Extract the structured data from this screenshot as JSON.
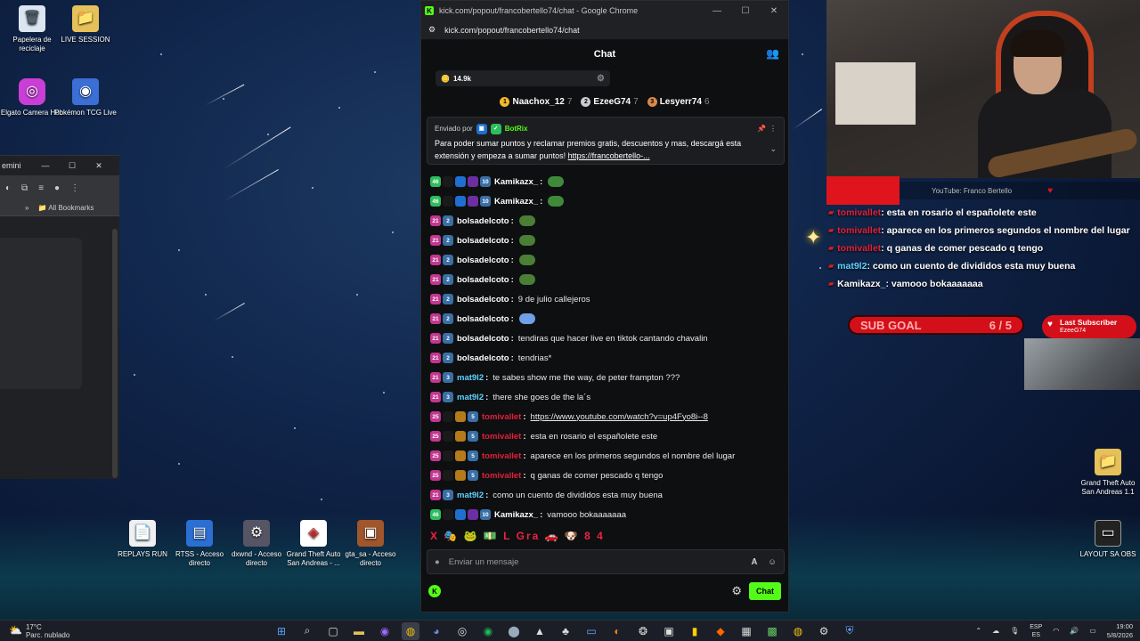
{
  "desktop": {
    "icons": [
      {
        "label": "Papelera de reciclaje",
        "glyph": "🗑"
      },
      {
        "label": "LIVE SESSION",
        "glyph": "📁"
      },
      {
        "label": "Elgato Camera Hub",
        "glyph": "◎"
      },
      {
        "label": "Pokémon TCG Live",
        "glyph": "◉"
      },
      {
        "label": "REPLAYS RUN",
        "glyph": "📄"
      },
      {
        "label": "RTSS - Acceso directo",
        "glyph": "▤"
      },
      {
        "label": "dxwnd - Acceso directo",
        "glyph": "⚙"
      },
      {
        "label": "Grand Theft Auto San Andreas - ...",
        "glyph": "◈"
      },
      {
        "label": "gta_sa - Acceso directo",
        "glyph": "▣"
      },
      {
        "label": "Grand Theft Auto San Andreas 1.1",
        "glyph": "📁"
      },
      {
        "label": "LAYOUT SA OBS",
        "glyph": "▭"
      }
    ]
  },
  "bg_window": {
    "title": "emini",
    "bookmarks": "All Bookmarks",
    "bookmarks_chevron": "»"
  },
  "chat_window": {
    "title": "kick.com/popout/francobertello74/chat - Google Chrome",
    "url": "kick.com/popout/francobertello74/chat",
    "header": "Chat",
    "points": "14.9k",
    "leaderboard": [
      {
        "rank": "1",
        "name": "Naachox_12",
        "count": "7",
        "color": "#f5b829"
      },
      {
        "rank": "2",
        "name": "EzeeG74",
        "count": "7",
        "color": "#c9ccd1"
      },
      {
        "rank": "3",
        "name": "Lesyerr74",
        "count": "6",
        "color": "#d88a4a"
      }
    ],
    "pinned": {
      "sent_by": "Enviado por",
      "bot": "BotRix",
      "text": "Para poder sumar puntos y reclamar premios gratis, descuentos y mas, descargá esta extensión y empeza a sumar puntos!",
      "link": "https://francobertello-..."
    },
    "messages": [
      {
        "user": "Kamikazx_",
        "sep": ":",
        "text": "",
        "color": "#ffffff",
        "badges": [
          "#2dbd5e",
          "#1a1a1a",
          "#1f6fd1",
          "#6b2ea3",
          "#3a6fa5"
        ],
        "badge_text": [
          "46",
          "",
          "",
          "",
          "10"
        ],
        "emote": "#3e8a3a"
      },
      {
        "user": "Kamikazx_",
        "sep": ":",
        "text": "",
        "color": "#ffffff",
        "badges": [
          "#2dbd5e",
          "#1a1a1a",
          "#1f6fd1",
          "#6b2ea3",
          "#3a6fa5"
        ],
        "badge_text": [
          "46",
          "",
          "",
          "",
          "10"
        ],
        "emote": "#3e8a3a"
      },
      {
        "user": "bolsadelcoto",
        "sep": ":",
        "text": "",
        "color": "#ffffff",
        "badges": [
          "#c2378f",
          "#3a6fa5"
        ],
        "badge_text": [
          "21",
          "2"
        ],
        "emote": "#4a7f35"
      },
      {
        "user": "bolsadelcoto",
        "sep": ":",
        "text": "",
        "color": "#ffffff",
        "badges": [
          "#c2378f",
          "#3a6fa5"
        ],
        "badge_text": [
          "21",
          "2"
        ],
        "emote": "#4a7f35"
      },
      {
        "user": "bolsadelcoto",
        "sep": ":",
        "text": "",
        "color": "#ffffff",
        "badges": [
          "#c2378f",
          "#3a6fa5"
        ],
        "badge_text": [
          "21",
          "2"
        ],
        "emote": "#4a7f35"
      },
      {
        "user": "bolsadelcoto",
        "sep": ":",
        "text": "",
        "color": "#ffffff",
        "badges": [
          "#c2378f",
          "#3a6fa5"
        ],
        "badge_text": [
          "21",
          "2"
        ],
        "emote": "#4a7f35"
      },
      {
        "user": "bolsadelcoto",
        "sep": ":",
        "text": "9 de julio callejeros",
        "color": "#ffffff",
        "badges": [
          "#c2378f",
          "#3a6fa5"
        ],
        "badge_text": [
          "21",
          "2"
        ]
      },
      {
        "user": "bolsadelcoto",
        "sep": ":",
        "text": "",
        "color": "#ffffff",
        "badges": [
          "#c2378f",
          "#3a6fa5"
        ],
        "badge_text": [
          "21",
          "2"
        ],
        "emote": "#6fa0e8"
      },
      {
        "user": "bolsadelcoto",
        "sep": ":",
        "text": "tendiras que hacer live en tiktok cantando chavalin",
        "color": "#ffffff",
        "badges": [
          "#c2378f",
          "#3a6fa5"
        ],
        "badge_text": [
          "21",
          "2"
        ]
      },
      {
        "user": "bolsadelcoto",
        "sep": ":",
        "text": "tendrias*",
        "color": "#ffffff",
        "badges": [
          "#c2378f",
          "#3a6fa5"
        ],
        "badge_text": [
          "21",
          "2"
        ]
      },
      {
        "user": "mat9l2",
        "sep": ":",
        "text": "te sabes show me the way, de peter frampton ???",
        "color": "#5ed3ff",
        "badges": [
          "#c2378f",
          "#3a6fa5"
        ],
        "badge_text": [
          "21",
          "3"
        ]
      },
      {
        "user": "mat9l2",
        "sep": ":",
        "text": "there she goes de the la´s",
        "color": "#5ed3ff",
        "badges": [
          "#c2378f",
          "#3a6fa5"
        ],
        "badge_text": [
          "21",
          "3"
        ]
      },
      {
        "user": "tomivallet",
        "sep": ":",
        "text": "https://www.youtube.com/watch?v=up4Fyo8i--8",
        "link": true,
        "color": "#e0213a",
        "badges": [
          "#c2378f",
          "#1a1a1a",
          "#b57a1a",
          "#3a6fa5"
        ],
        "badge_text": [
          "25",
          "",
          "",
          "5"
        ]
      },
      {
        "user": "tomivallet",
        "sep": ":",
        "text": "esta en rosario el españolete este",
        "color": "#e0213a",
        "badges": [
          "#c2378f",
          "#1a1a1a",
          "#b57a1a",
          "#3a6fa5"
        ],
        "badge_text": [
          "25",
          "",
          "",
          "5"
        ]
      },
      {
        "user": "tomivallet",
        "sep": ":",
        "text": "aparece en los primeros segundos el nombre del lugar",
        "color": "#e0213a",
        "badges": [
          "#c2378f",
          "#1a1a1a",
          "#b57a1a",
          "#3a6fa5"
        ],
        "badge_text": [
          "25",
          "",
          "",
          "5"
        ]
      },
      {
        "user": "tomivallet",
        "sep": ":",
        "text": "q ganas de comer pescado q tengo",
        "color": "#e0213a",
        "badges": [
          "#c2378f",
          "#1a1a1a",
          "#b57a1a",
          "#3a6fa5"
        ],
        "badge_text": [
          "25",
          "",
          "",
          "5"
        ]
      },
      {
        "user": "mat9l2",
        "sep": ":",
        "text": "como un cuento de divididos esta muy buena",
        "color": "#5ed3ff",
        "badges": [
          "#c2378f",
          "#3a6fa5"
        ],
        "badge_text": [
          "21",
          "3"
        ]
      },
      {
        "user": "Kamikazx_",
        "sep": ":",
        "text": "vamooo bokaaaaaaa",
        "color": "#ffffff",
        "badges": [
          "#2dbd5e",
          "#1a1a1a",
          "#1f6fd1",
          "#6b2ea3",
          "#3a6fa5"
        ],
        "badge_text": [
          "46",
          "",
          "",
          "",
          "10"
        ]
      }
    ],
    "emote_row": "X 🎭 🐸 💵 L Gra 🚗 🐶 8 4",
    "input_placeholder": "Enviar un mensaje",
    "send_label": "Chat"
  },
  "overlay": {
    "yt_label": "YouTube: Franco Bertello",
    "chat": [
      {
        "user": "tomivallet",
        "text": ": esta en rosario el españolete este",
        "color": "#e0213a"
      },
      {
        "user": "tomivallet",
        "text": ": aparece en los primeros segundos el nombre del lugar",
        "color": "#e0213a"
      },
      {
        "user": "tomivallet",
        "text": ": q ganas de comer pescado q tengo",
        "color": "#e0213a"
      },
      {
        "user": "mat9l2",
        "text": ": como un cuento de divididos esta muy buena",
        "color": "#5ed3ff"
      },
      {
        "user": "Kamikazx_",
        "text": ": vamooo bokaaaaaaa",
        "color": "#ffffff"
      }
    ],
    "sub_goal_label": "SUB GOAL",
    "sub_goal_value": "6 / 5",
    "last_sub_label": "Last Subscriber",
    "last_sub_name": "EzeeG74"
  },
  "taskbar": {
    "temp": "17°C",
    "weather": "Parc. nublado",
    "lang1": "ESP",
    "lang2": "ES",
    "time": "19:00",
    "date": "5/8/2026"
  }
}
